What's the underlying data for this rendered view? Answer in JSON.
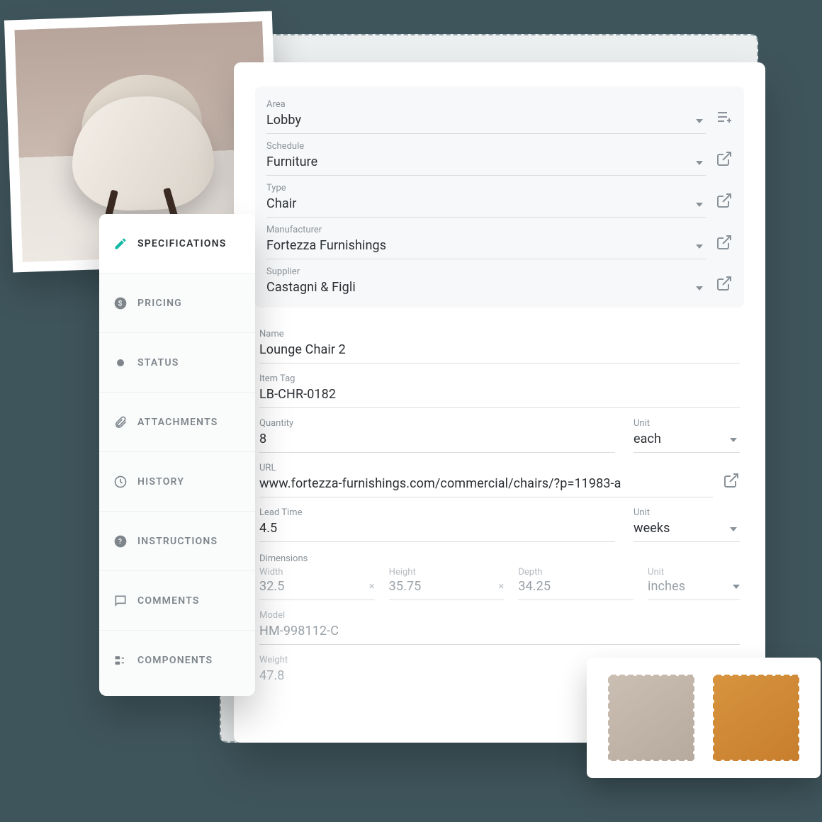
{
  "sidebar": {
    "items": [
      {
        "label": "SPECIFICATIONS",
        "icon": "pencil-icon",
        "active": true
      },
      {
        "label": "PRICING",
        "icon": "dollar-icon"
      },
      {
        "label": "STATUS",
        "icon": "dot-icon"
      },
      {
        "label": "ATTACHMENTS",
        "icon": "paperclip-icon"
      },
      {
        "label": "HISTORY",
        "icon": "clock-icon"
      },
      {
        "label": "INSTRUCTIONS",
        "icon": "help-icon"
      },
      {
        "label": "COMMENTS",
        "icon": "comment-icon"
      },
      {
        "label": "COMPONENTS",
        "icon": "components-icon"
      }
    ]
  },
  "spec_header": {
    "area": {
      "label": "Area",
      "value": "Lobby"
    },
    "schedule": {
      "label": "Schedule",
      "value": "Furniture"
    },
    "type": {
      "label": "Type",
      "value": "Chair"
    },
    "manufacturer": {
      "label": "Manufacturer",
      "value": "Fortezza Furnishings"
    },
    "supplier": {
      "label": "Supplier",
      "value": "Castagni & Figli"
    }
  },
  "spec": {
    "name": {
      "label": "Name",
      "value": "Lounge Chair 2"
    },
    "item_tag": {
      "label": "Item Tag",
      "value": "LB-CHR-0182"
    },
    "quantity": {
      "label": "Quantity",
      "value": "8"
    },
    "quantity_unit": {
      "label": "Unit",
      "value": "each"
    },
    "url": {
      "label": "URL",
      "value": "www.fortezza-furnishings.com/commercial/chairs/?p=11983-a"
    },
    "lead_time": {
      "label": "Lead Time",
      "value": "4.5"
    },
    "lead_time_unit": {
      "label": "Unit",
      "value": "weeks"
    },
    "dimensions_label": "Dimensions",
    "dim_width": {
      "label": "Width",
      "value": "32.5"
    },
    "dim_height": {
      "label": "Height",
      "value": "35.75"
    },
    "dim_depth": {
      "label": "Depth",
      "value": "34.25"
    },
    "dim_unit": {
      "label": "Unit",
      "value": "inches"
    },
    "model": {
      "label": "Model",
      "value": "HM-998112-C"
    },
    "weight": {
      "label": "Weight",
      "value": "47.8"
    }
  },
  "swatches": {
    "items": [
      {
        "name": "swatch-beige",
        "color": "#c0b4a8"
      },
      {
        "name": "swatch-amber",
        "color": "#d18a38"
      }
    ]
  },
  "product_image": {
    "name": "lounge-chair-photo"
  }
}
